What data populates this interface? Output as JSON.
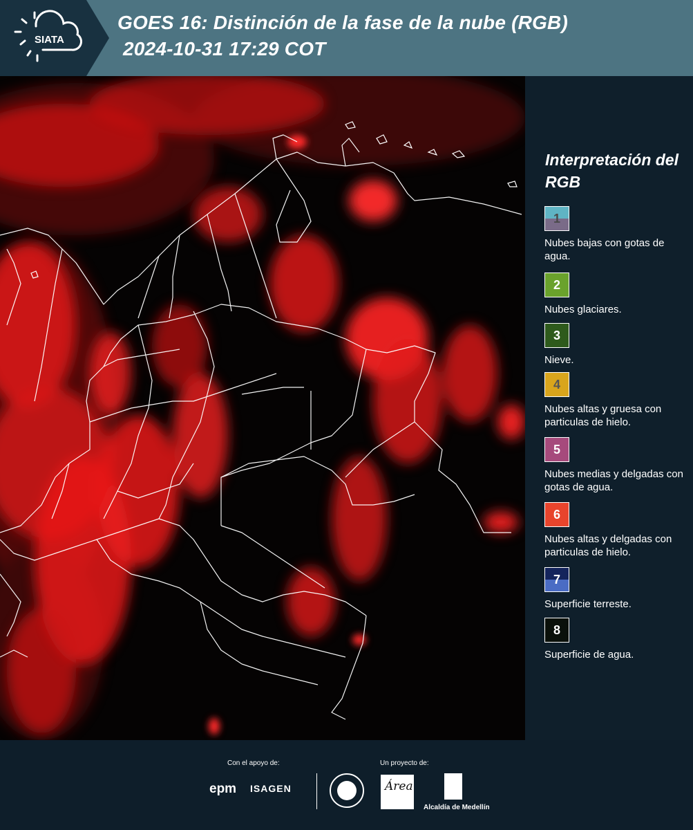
{
  "header": {
    "logo_text": "SIATA",
    "title_line1": "GOES 16: Distinción de la fase de la nube (RGB)",
    "title_line2": "2024-10-31 17:29 COT"
  },
  "legend": {
    "title": "Interpretación del RGB",
    "items": [
      {
        "num": "1",
        "label": "Nubes bajas con gotas de agua.",
        "color_top": "#5fb4c4",
        "color_bottom": "#7a6b88",
        "num_color": "#4a4a4a"
      },
      {
        "num": "2",
        "label": "Nubes glaciares.",
        "color_top": "#6aa22c",
        "color_bottom": "#6aa22c",
        "num_color": "#ffffff"
      },
      {
        "num": "3",
        "label": "Nieve.",
        "color_top": "#2e5a1c",
        "color_bottom": "#2e5a1c",
        "num_color": "#ffffff"
      },
      {
        "num": "4",
        "label": "Nubes altas y gruesa con particulas de hielo.",
        "color_top": "#d9a51c",
        "color_bottom": "#d9a51c",
        "num_color": "#555555"
      },
      {
        "num": "5",
        "label": "Nubes medias y delgadas con gotas de agua.",
        "color_top": "#a64a7c",
        "color_bottom": "#a64a7c",
        "num_color": "#ffffff"
      },
      {
        "num": "6",
        "label": "Nubes altas y delgadas con particulas de hielo.",
        "color_top": "#e8442c",
        "color_bottom": "#e8442c",
        "num_color": "#ffffff"
      },
      {
        "num": "7",
        "label": "Superficie terreste.",
        "color_top": "#14245c",
        "color_bottom": "#4a6cc4",
        "num_color": "#ffffff"
      },
      {
        "num": "8",
        "label": "Superficie de agua.",
        "color_top": "#0a100a",
        "color_bottom": "#0a100a",
        "num_color": "#ffffff"
      }
    ]
  },
  "footer": {
    "support_label": "Con el apoyo de:",
    "project_label": "Un proyecto de:",
    "epm": "epm",
    "isagen": "ISAGEN",
    "area": "Área",
    "alcaldia": "Alcaldía de Medellín"
  },
  "colors": {
    "header_bg": "#4d7482",
    "panel_bg": "#0f1f2b",
    "cloud_red": "#ff2020"
  }
}
